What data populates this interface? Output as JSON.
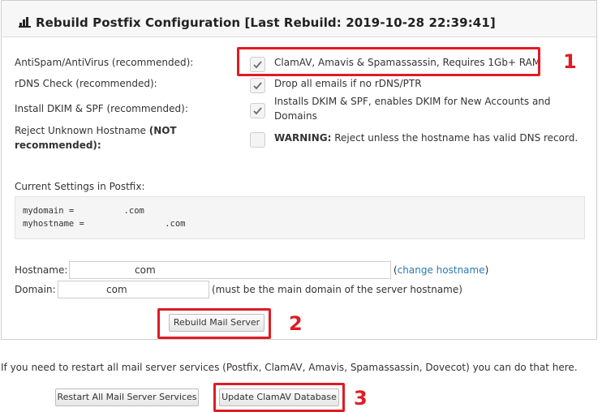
{
  "panel": {
    "title": "Rebuild Postfix Configuration [Last Rebuild: 2019-10-28 22:39:41]",
    "icon": "bar-chart-icon"
  },
  "options": [
    {
      "label": "AntiSpam/AntiVirus (recommended):",
      "description": "ClamAV, Amavis & Spamassassin, Requires 1Gb+ RAM",
      "checked": true
    },
    {
      "label": "rDNS Check (recommended):",
      "description": "Drop all emails if no rDNS/PTR",
      "checked": true
    },
    {
      "label": "Install DKIM & SPF (recommended):",
      "description_line1": "Installs DKIM & SPF, enables DKIM for New Accounts and",
      "description_line2": "Domains",
      "checked": true
    },
    {
      "label_line1": "Reject Unknown Hostname ",
      "label_bold1": "(NOT",
      "label_bold2": "recommended):",
      "warning_strong": "WARNING:",
      "warning_text": " Reject unless the hostname has valid DNS record.",
      "checked": false
    }
  ],
  "settings": {
    "label": "Current Settings in Postfix:",
    "mydomain_key": "mydomain = ",
    "mydomain_suffix": ".com",
    "myhostname_key": "myhostname = ",
    "myhostname_suffix": ".com"
  },
  "form": {
    "hostname_label": "Hostname:",
    "hostname_value": "com",
    "change_open": "(",
    "change_link": "change hostname",
    "change_close": ")",
    "domain_label": "Domain:",
    "domain_value": "com",
    "domain_hint": "(must be the main domain of the server hostname)",
    "rebuild_button": "Rebuild Mail Server"
  },
  "restart_text": "If you need to restart all mail server services (Postfix, ClamAV, Amavis, Spamassassin, Dovecot) you can do that here.",
  "buttons": {
    "restart_all": "Restart All Mail Server Services",
    "update_clamav": "Update ClamAV Database"
  },
  "callouts": [
    "1",
    "2",
    "3"
  ],
  "colors": {
    "callout": "#e01b24",
    "link": "#2a7ab0"
  }
}
